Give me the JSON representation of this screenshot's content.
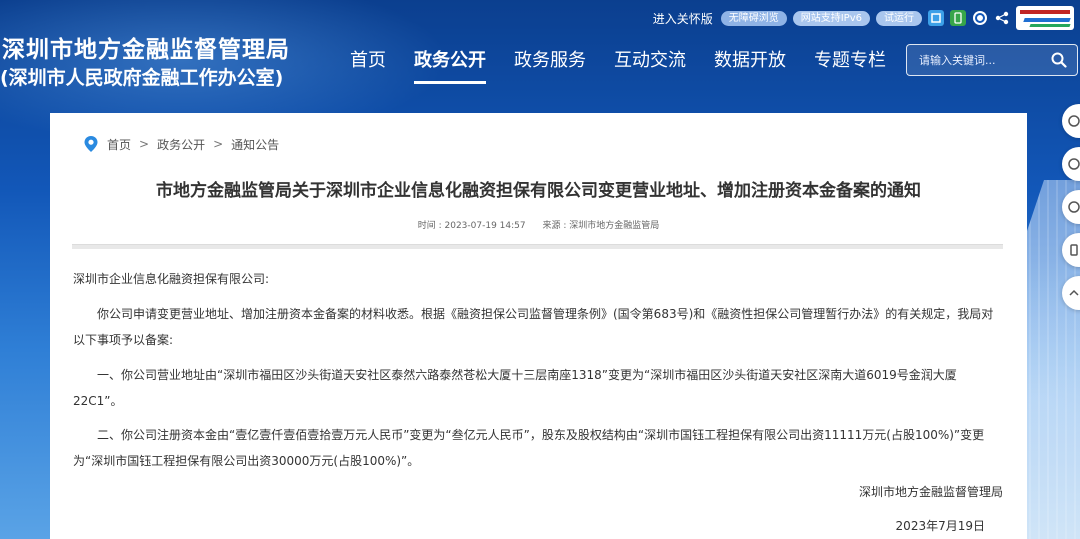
{
  "header": {
    "site_title": "深圳市地方金融监督管理局",
    "site_subtitle": "(深圳市人民政府金融工作办公室)",
    "util": {
      "care_mode": "进入关怀版",
      "accessible": "无障碍浏览",
      "ipv6": "网站支持IPv6",
      "trial": "试运行"
    },
    "nav": [
      "首页",
      "政务公开",
      "政务服务",
      "互动交流",
      "数据开放",
      "专题专栏"
    ],
    "nav_active_index": 1,
    "search_placeholder": "请输入关键词..."
  },
  "breadcrumb": [
    "首页",
    "政务公开",
    "通知公告"
  ],
  "article": {
    "title": "市地方金融监管局关于深圳市企业信息化融资担保有限公司变更营业地址、增加注册资本金备案的通知",
    "time": "时间 : 2023-07-19 14:57",
    "source": "来源 : 深圳市地方金融监管局",
    "salutation": "深圳市企业信息化融资担保有限公司:",
    "paragraphs": [
      "你公司申请变更营业地址、增加注册资本金备案的材料收悉。根据《融资担保公司监督管理条例》(国令第683号)和《融资性担保公司管理暂行办法》的有关规定，我局对以下事项予以备案:",
      "一、你公司营业地址由“深圳市福田区沙头街道天安社区泰然六路泰然苍松大厦十三层南座1318”变更为“深圳市福田区沙头街道天安社区深南大道6019号金润大厦22C1”。",
      "二、你公司注册资本金由“壹亿壹仟壹佰壹拾壹万元人民币”变更为“叁亿元人民币”，股东及股权结构由“深圳市国钰工程担保有限公司出资11111万元(占股100%)”变更为“深圳市国钰工程担保有限公司出资30000万元(占股100%)”。"
    ],
    "signature": "深圳市地方金融监督管理局",
    "date": "2023年7月19日"
  },
  "icons": {
    "search": "search-icon",
    "location": "location-pin-icon",
    "colors": {
      "accent_blue": "#1257b8",
      "pill": "#a9c6ee",
      "pin_blue": "#2a8ae0"
    }
  }
}
